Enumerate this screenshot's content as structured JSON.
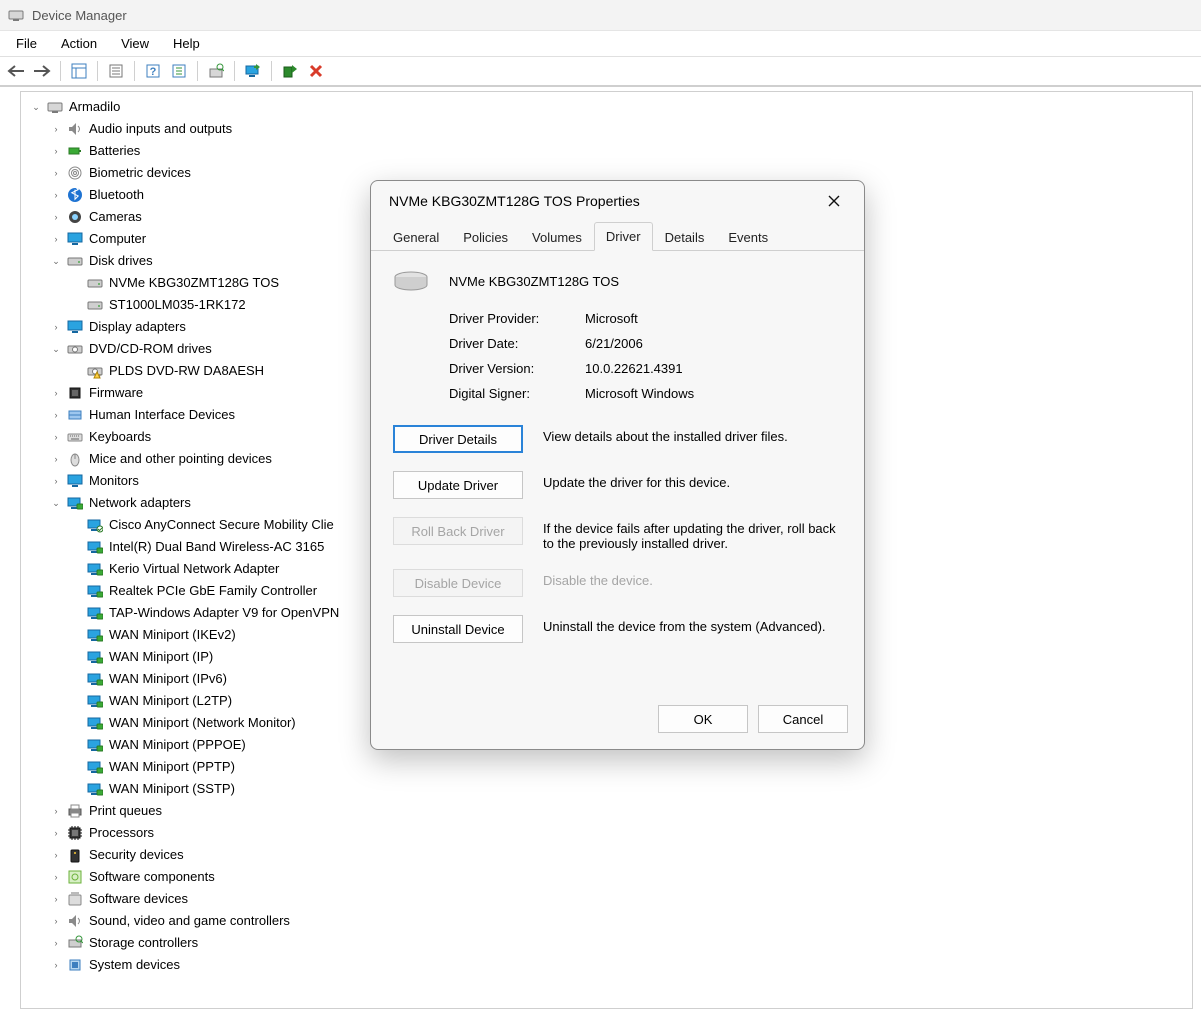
{
  "window": {
    "title": "Device Manager"
  },
  "menu": {
    "file": "File",
    "action": "Action",
    "view": "View",
    "help": "Help"
  },
  "tree": {
    "root": "Armadilo",
    "items": [
      {
        "label": "Audio inputs and outputs",
        "icon": "speaker"
      },
      {
        "label": "Batteries",
        "icon": "battery"
      },
      {
        "label": "Biometric devices",
        "icon": "fingerprint"
      },
      {
        "label": "Bluetooth",
        "icon": "bluetooth"
      },
      {
        "label": "Cameras",
        "icon": "camera"
      },
      {
        "label": "Computer",
        "icon": "monitor"
      },
      {
        "label": "Disk drives",
        "icon": "drive",
        "expanded": true,
        "children": [
          {
            "label": "NVMe KBG30ZMT128G TOS",
            "icon": "drive"
          },
          {
            "label": "ST1000LM035-1RK172",
            "icon": "drive"
          }
        ]
      },
      {
        "label": "Display adapters",
        "icon": "monitor"
      },
      {
        "label": "DVD/CD-ROM drives",
        "icon": "disc",
        "expanded": true,
        "children": [
          {
            "label": "PLDS DVD-RW DA8AESH",
            "icon": "disc-warn"
          }
        ]
      },
      {
        "label": "Firmware",
        "icon": "chip"
      },
      {
        "label": "Human Interface Devices",
        "icon": "hid"
      },
      {
        "label": "Keyboards",
        "icon": "keyboard"
      },
      {
        "label": "Mice and other pointing devices",
        "icon": "mouse"
      },
      {
        "label": "Monitors",
        "icon": "monitor"
      },
      {
        "label": "Network adapters",
        "icon": "net",
        "expanded": true,
        "children": [
          {
            "label": "Cisco AnyConnect Secure Mobility Clie",
            "icon": "net-spec"
          },
          {
            "label": "Intel(R) Dual Band Wireless-AC 3165",
            "icon": "net"
          },
          {
            "label": "Kerio Virtual Network Adapter",
            "icon": "net"
          },
          {
            "label": "Realtek PCIe GbE Family Controller",
            "icon": "net"
          },
          {
            "label": "TAP-Windows Adapter V9 for OpenVPN",
            "icon": "net"
          },
          {
            "label": "WAN Miniport (IKEv2)",
            "icon": "net"
          },
          {
            "label": "WAN Miniport (IP)",
            "icon": "net"
          },
          {
            "label": "WAN Miniport (IPv6)",
            "icon": "net"
          },
          {
            "label": "WAN Miniport (L2TP)",
            "icon": "net"
          },
          {
            "label": "WAN Miniport (Network Monitor)",
            "icon": "net"
          },
          {
            "label": "WAN Miniport (PPPOE)",
            "icon": "net"
          },
          {
            "label": "WAN Miniport (PPTP)",
            "icon": "net"
          },
          {
            "label": "WAN Miniport (SSTP)",
            "icon": "net"
          }
        ]
      },
      {
        "label": "Print queues",
        "icon": "printer"
      },
      {
        "label": "Processors",
        "icon": "cpu"
      },
      {
        "label": "Security devices",
        "icon": "security"
      },
      {
        "label": "Software components",
        "icon": "swcomp"
      },
      {
        "label": "Software devices",
        "icon": "swdev"
      },
      {
        "label": "Sound, video and game controllers",
        "icon": "speaker"
      },
      {
        "label": "Storage controllers",
        "icon": "storage"
      },
      {
        "label": "System devices",
        "icon": "system"
      }
    ]
  },
  "dialog": {
    "title": "NVMe KBG30ZMT128G TOS Properties",
    "tabs": [
      "General",
      "Policies",
      "Volumes",
      "Driver",
      "Details",
      "Events"
    ],
    "activeTab": "Driver",
    "deviceName": "NVMe KBG30ZMT128G TOS",
    "info": {
      "providerLabel": "Driver Provider:",
      "providerValue": "Microsoft",
      "dateLabel": "Driver Date:",
      "dateValue": "6/21/2006",
      "versionLabel": "Driver Version:",
      "versionValue": "10.0.22621.4391",
      "signerLabel": "Digital Signer:",
      "signerValue": "Microsoft Windows"
    },
    "actions": {
      "details": {
        "btn": "Driver Details",
        "desc": "View details about the installed driver files."
      },
      "update": {
        "btn": "Update Driver",
        "desc": "Update the driver for this device."
      },
      "rollback": {
        "btn": "Roll Back Driver",
        "desc": "If the device fails after updating the driver, roll back to the previously installed driver."
      },
      "disable": {
        "btn": "Disable Device",
        "desc": "Disable the device."
      },
      "uninstall": {
        "btn": "Uninstall Device",
        "desc": "Uninstall the device from the system (Advanced)."
      }
    },
    "footer": {
      "ok": "OK",
      "cancel": "Cancel"
    }
  }
}
